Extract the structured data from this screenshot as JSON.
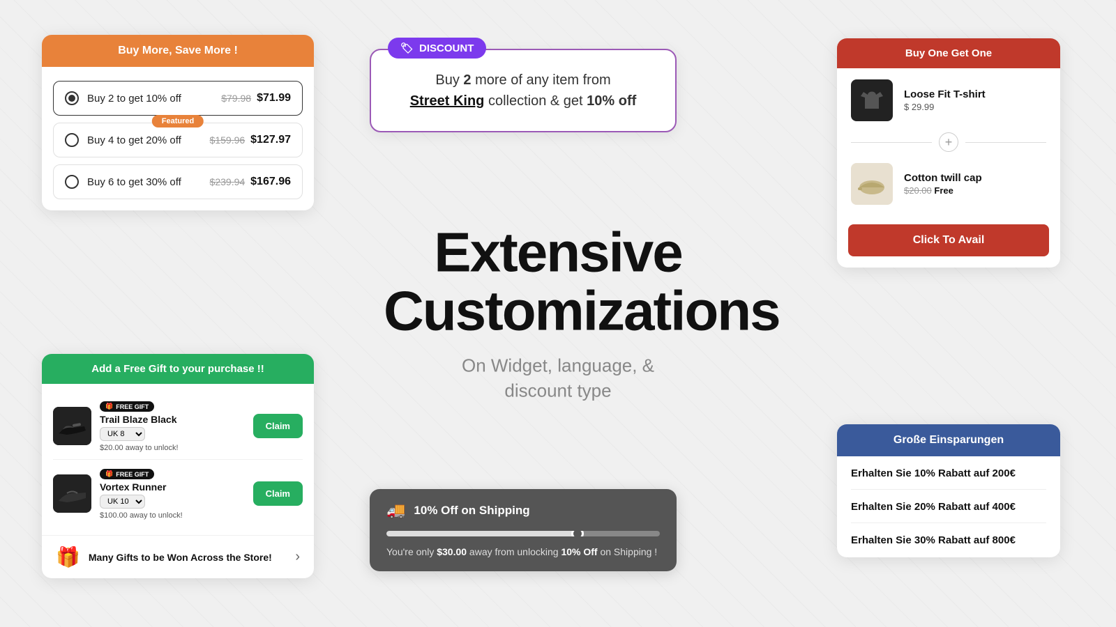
{
  "background": "#f0f0f0",
  "center": {
    "title": "Extensive Customizations",
    "subtitle": "On Widget, language, &\ndiscount type"
  },
  "buy_more_widget": {
    "header": "Buy More, Save More !",
    "options": [
      {
        "label": "Buy 2 to get 10% off",
        "original": "$79.98",
        "discounted": "$71.99",
        "selected": true,
        "featured": false
      },
      {
        "label": "Buy 4 to get 20% off",
        "original": "$159.96",
        "discounted": "$127.97",
        "selected": false,
        "featured": true,
        "featured_label": "Featured"
      },
      {
        "label": "Buy 6 to get 30% off",
        "original": "$239.94",
        "discounted": "$167.96",
        "selected": false,
        "featured": false
      }
    ]
  },
  "discount_widget": {
    "badge_label": "DISCOUNT",
    "badge_icon": "🏷",
    "line1": "Buy",
    "bold1": "2",
    "line2": "more of any item from",
    "brand": "Street King",
    "line3": "collection & get",
    "discount": "10% off"
  },
  "bogo_widget": {
    "header": "Buy One Get One",
    "item1": {
      "name": "Loose Fit T-shirt",
      "price": "$ 29.99"
    },
    "item2": {
      "name": "Cotton twill cap",
      "original_price": "$20.00",
      "price": "Free"
    },
    "cta": "Click To Avail"
  },
  "free_gift_widget": {
    "header": "Add a Free Gift to your purchase !!",
    "items": [
      {
        "name": "Trail Blaze Black",
        "badge": "FREE GIFT",
        "size": "UK 8",
        "unlock_text": "$20.00 away to unlock!",
        "cta": "Claim"
      },
      {
        "name": "Vortex Runner",
        "badge": "FREE GIFT",
        "size": "UK 10",
        "unlock_text": "$100.00 away to unlock!",
        "cta": "Claim"
      }
    ],
    "footer_text": "Many Gifts to be Won Across the Store!"
  },
  "shipping_widget": {
    "icon": "🚚",
    "title": "10% Off on Shipping",
    "progress": 70,
    "text_before": "You're only",
    "amount": "$30.00",
    "text_middle": "away from unlocking",
    "discount": "10% Off",
    "text_after": "on Shipping !"
  },
  "german_widget": {
    "header": "Große Einsparungen",
    "options": [
      "Erhalten Sie 10% Rabatt auf 200€",
      "Erhalten Sie 20% Rabatt auf 400€",
      "Erhalten Sie 30% Rabatt auf 800€"
    ]
  }
}
